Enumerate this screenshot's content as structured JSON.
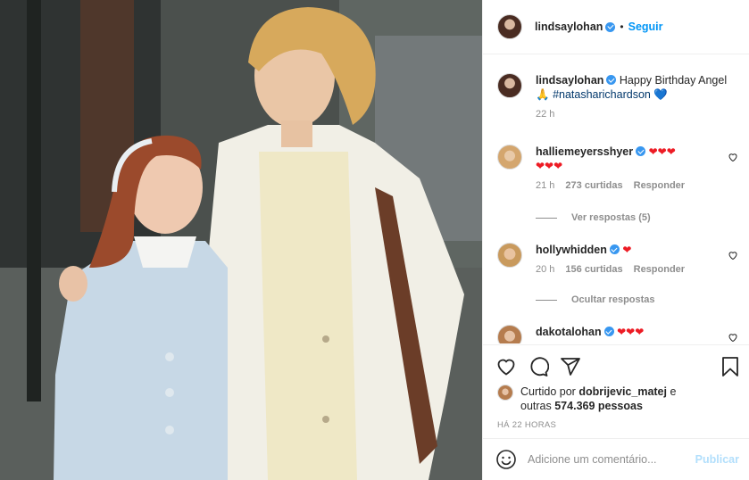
{
  "header": {
    "username": "lindsaylohan",
    "separator": "•",
    "follow_label": "Seguir"
  },
  "caption": {
    "username": "lindsaylohan",
    "text_before": "Happy Birthday Angel",
    "emoji": "🙏",
    "hashtag": "#natasharichardson",
    "heart": "💙",
    "time": "22 h"
  },
  "comments": [
    {
      "username": "halliemeyersshyer",
      "hearts_line1": "❤❤❤",
      "hearts_line2": "❤❤❤",
      "time": "21 h",
      "likes": "273 curtidas",
      "reply_label": "Responder",
      "thread_label": "Ver respostas (5)"
    },
    {
      "username": "hollywhidden",
      "hearts_line1": "❤",
      "time": "20 h",
      "likes": "156 curtidas",
      "reply_label": "Responder",
      "thread_label": "Ocultar respostas"
    },
    {
      "username": "dakotalohan",
      "hearts_line1": "❤❤❤"
    }
  ],
  "likes": {
    "prefix": "Curtido por",
    "user": "dobrijevic_matej",
    "middle": "e",
    "count_prefix": "outras",
    "count": "574.369 pessoas"
  },
  "timestamp": "Há 22 horas",
  "add_comment": {
    "placeholder": "Adicione um comentário...",
    "publish_label": "Publicar"
  },
  "icons": [
    "heart-icon",
    "comment-icon",
    "share-icon",
    "bookmark-icon",
    "emoji-icon",
    "verified-badge-icon"
  ],
  "colors": {
    "accent": "#0095f6",
    "heart": "#ed1b24",
    "muted": "#8e8e8e",
    "publish_disabled": "#b2dffc"
  }
}
